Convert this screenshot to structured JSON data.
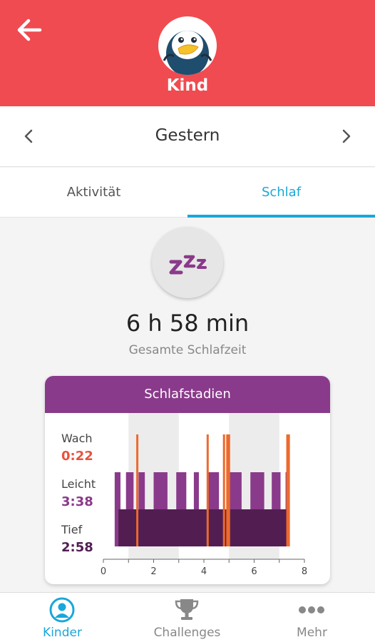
{
  "header": {
    "name": "Kind",
    "back_icon": "arrow-left-icon",
    "avatar_icon": "penguin-avatar-icon",
    "color": "#f04b50"
  },
  "date_nav": {
    "title": "Gestern",
    "prev_icon": "chevron-left-icon",
    "next_icon": "chevron-right-icon"
  },
  "tabs": [
    {
      "label": "Aktivität",
      "active": false
    },
    {
      "label": "Schlaf",
      "active": true
    }
  ],
  "summary": {
    "icon": "zzz-icon",
    "total": "6 h 58 min",
    "total_label": "Gesamte Schlafzeit"
  },
  "card": {
    "title": "Schlafstadien",
    "stages": [
      {
        "name": "Wach",
        "value": "0:22",
        "color": "#e8523f"
      },
      {
        "name": "Leicht",
        "value": "3:38",
        "color": "#8a3a8a"
      },
      {
        "name": "Tief",
        "value": "2:58",
        "color": "#521e52"
      }
    ]
  },
  "chart_data": {
    "type": "bar",
    "xlim": [
      0,
      8
    ],
    "xticks": [
      "0",
      "2",
      "4",
      "6",
      "8"
    ],
    "shaded_ranges": [
      [
        1,
        3
      ],
      [
        5,
        7
      ]
    ],
    "light_segments": [
      [
        0.45,
        0.68
      ],
      [
        0.9,
        1.2
      ],
      [
        1.4,
        1.65
      ],
      [
        2.0,
        2.55
      ],
      [
        2.9,
        3.3
      ],
      [
        3.6,
        3.8
      ],
      [
        4.15,
        4.6
      ],
      [
        4.9,
        5.5
      ],
      [
        5.85,
        6.4
      ],
      [
        6.7,
        7.05
      ],
      [
        7.25,
        7.38
      ]
    ],
    "deep_range": [
      0.6,
      7.35
    ],
    "awake_times": [
      1.35,
      4.15,
      4.8,
      4.93,
      5.0,
      7.32,
      7.38
    ],
    "colors": {
      "light": "#8a3a8a",
      "deep": "#521e52",
      "awake": "#ec6a2d",
      "shade": "#ececec"
    }
  },
  "bottom_nav": [
    {
      "label": "Kinder",
      "icon": "kids-user-icon",
      "active": true
    },
    {
      "label": "Challenges",
      "icon": "trophy-icon",
      "active": false
    },
    {
      "label": "Mehr",
      "icon": "more-dots-icon",
      "active": false
    }
  ]
}
